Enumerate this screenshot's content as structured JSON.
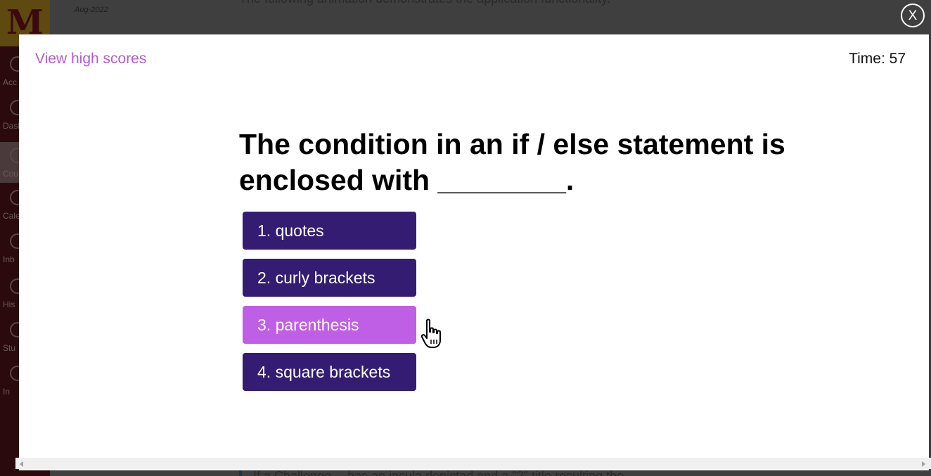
{
  "background": {
    "logo_glyph": "M",
    "date": "Aug-2022",
    "top_text": "The following animation demonstrates the application functionality.",
    "bottom_text": "If a Challenge… has an insula depicted and a \"?\" title resulting the",
    "nav": [
      {
        "label": "Acc"
      },
      {
        "label": "Dash"
      },
      {
        "label": "Cou"
      },
      {
        "label": "Cale"
      },
      {
        "label": "Inb"
      },
      {
        "label": "His"
      },
      {
        "label": "Stu"
      },
      {
        "label": "In"
      }
    ]
  },
  "modal": {
    "close_label": "X",
    "high_scores_label": "View high scores",
    "timer_label": "Time: 57",
    "question": "The condition in an if / else statement is enclosed with ________.",
    "answers": [
      {
        "label": "1. quotes",
        "state": "default"
      },
      {
        "label": "2. curly brackets",
        "state": "default"
      },
      {
        "label": "3. parenthesis",
        "state": "hover"
      },
      {
        "label": "4. square brackets",
        "state": "default"
      }
    ],
    "cursor": "hand-pointer-icon"
  },
  "colors": {
    "answer_default": "#341c72",
    "answer_hover": "#bf5fe6",
    "link": "#b45ad6",
    "overlay": "#3f3f3f"
  }
}
